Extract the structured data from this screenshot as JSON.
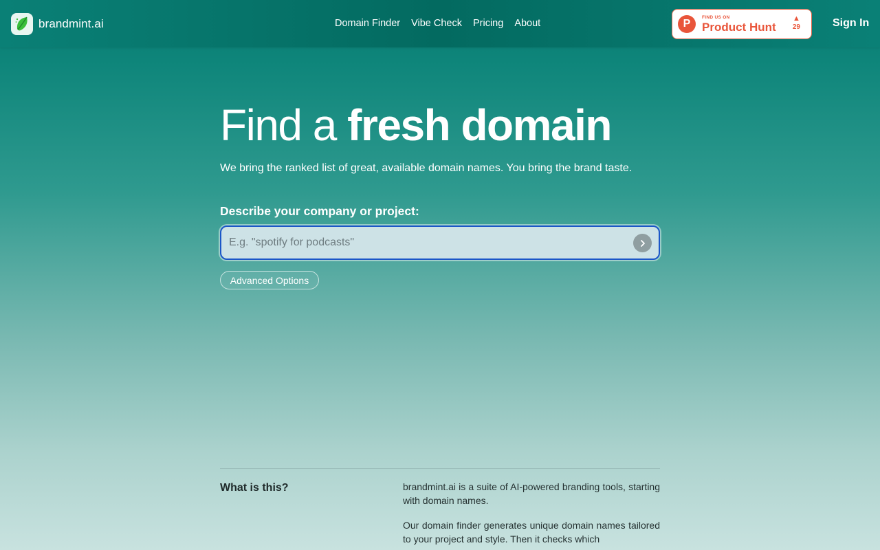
{
  "header": {
    "logo_text": "brandmint.ai",
    "nav": [
      "Domain Finder",
      "Vibe Check",
      "Pricing",
      "About"
    ],
    "product_hunt": {
      "small_text": "FIND US ON",
      "big_text": "Product Hunt",
      "votes": "29",
      "color": "#e9553a"
    },
    "sign_in": "Sign In"
  },
  "hero": {
    "title_light": "Find a ",
    "title_bold": "fresh domain",
    "subtitle": "We bring the ranked list of great, available domain names. You bring the brand taste."
  },
  "search": {
    "label": "Describe your company or project:",
    "placeholder": "E.g. \"spotify for podcasts\"",
    "value": "",
    "advanced_label": "Advanced Options"
  },
  "about": {
    "title": "What is this?",
    "p1": "brandmint.ai is a suite of AI-powered branding tools, starting with domain names.",
    "p2": "Our domain finder generates unique domain names tailored to your project and style. Then it checks which"
  },
  "colors": {
    "accent": "#067a70",
    "focus_border": "#1b56c8"
  }
}
